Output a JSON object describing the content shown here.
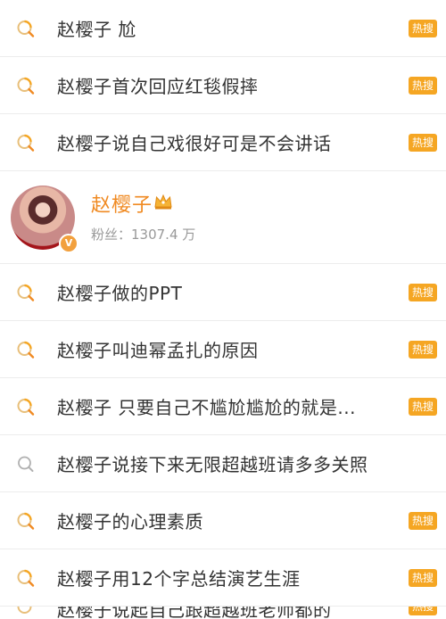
{
  "colors": {
    "hot_badge": "#f5a623",
    "user_name": "#f08a22",
    "search_icon_hot": "#f5a623"
  },
  "badge_label": "热搜",
  "rows_top": [
    {
      "text": "赵樱子 尬",
      "hot": true
    },
    {
      "text": "赵樱子首次回应红毯假摔",
      "hot": true
    },
    {
      "text": "赵樱子说自己戏很好可是不会讲话",
      "hot": true
    }
  ],
  "user": {
    "name": "赵樱子",
    "fans": "粉丝：1307.4 万",
    "verified_label": "V"
  },
  "rows_bottom": [
    {
      "text": "赵樱子做的PPT",
      "hot": true
    },
    {
      "text": "赵樱子叫迪幂孟扎的原因",
      "hot": true
    },
    {
      "text": "赵樱子 只要自己不尴尬尴尬的就是...",
      "hot": true
    },
    {
      "text": "赵樱子说接下来无限超越班请多多关照",
      "hot": false
    },
    {
      "text": "赵樱子的心理素质",
      "hot": true
    },
    {
      "text": "赵樱子用12个字总结演艺生涯",
      "hot": true
    },
    {
      "text": "赵樱子说起自己跟超越班老师都的",
      "hot": true
    }
  ]
}
